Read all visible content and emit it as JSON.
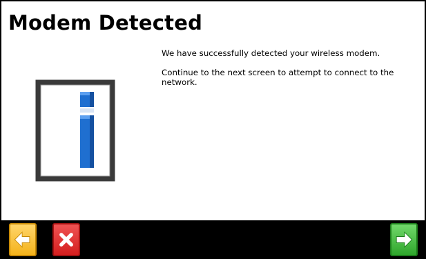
{
  "screen": {
    "title": "Modem Detected",
    "message_line1": "We have successfully detected your wireless modem.",
    "message_line2": "Continue to the next screen to attempt to connect to the network."
  },
  "icons": {
    "info": "info-icon",
    "back": "arrow-left-icon",
    "cancel": "close-icon",
    "next": "arrow-right-icon"
  },
  "colors": {
    "back_button": "#f4b31c",
    "cancel_button": "#d41f1f",
    "next_button": "#2fa62c",
    "info_glyph": "#1a6fd6",
    "bottom_bar": "#000000"
  }
}
